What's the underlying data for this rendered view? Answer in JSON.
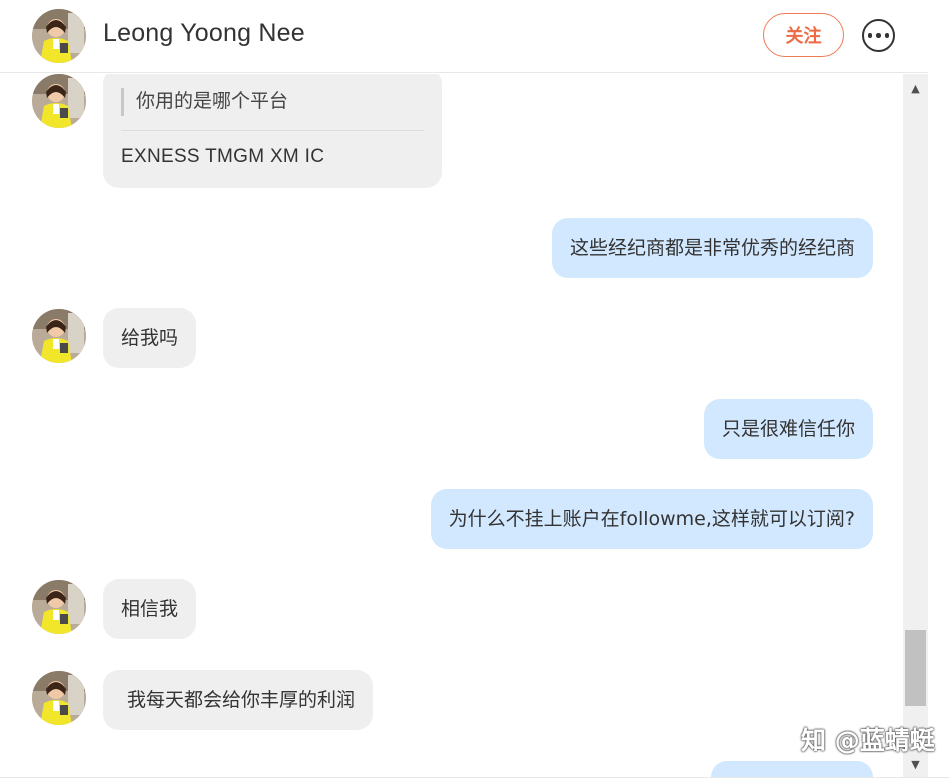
{
  "header": {
    "name": "Leong Yoong Nee",
    "follow_label": "关注"
  },
  "messages": {
    "quote": {
      "quoted_text": "你用的是哪个平台",
      "reply_text": "EXNESS TMGM XM IC"
    },
    "m1": "这些经纪商都是非常优秀的经纪商",
    "m2": "给我吗",
    "m3": "只是很难信任你",
    "m4": "为什么不挂上账户在followme,这样就可以订阅?",
    "m5": "相信我",
    "m6": " 我每天都会给你丰厚的利润"
  },
  "watermark": "知 @蓝蜻蜓",
  "colors": {
    "incoming_bubble": "#efefef",
    "outgoing_bubble": "#d1e8ff",
    "follow_accent": "#ee6a43"
  }
}
